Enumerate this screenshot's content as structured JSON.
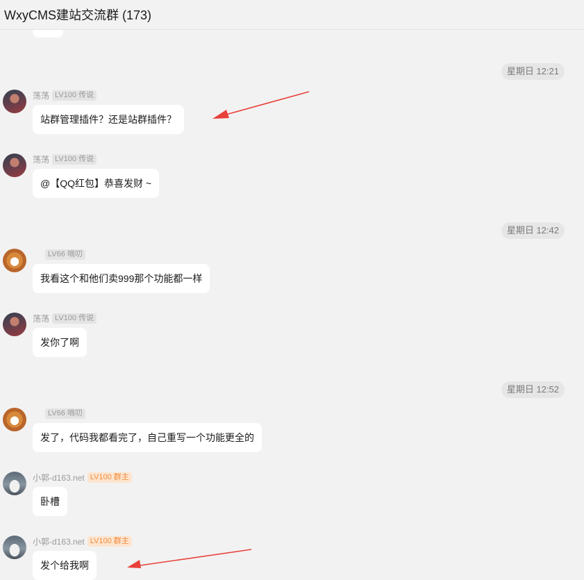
{
  "header": {
    "title": "WxyCMS建站交流群 (173)"
  },
  "timestamps": [
    "星期日 12:21",
    "星期日 12:42",
    "星期日 12:52"
  ],
  "messages": [
    {
      "nick": "荡荡",
      "badge": "LV100 传说",
      "text": "站群管理插件？还是站群插件？"
    },
    {
      "nick": "荡荡",
      "badge": "LV100 传说",
      "text": "@【QQ红包】恭喜发财 ~"
    },
    {
      "nick": "",
      "badge": "LV66 嘀叨",
      "text": "我看这个和他们卖999那个功能都一样"
    },
    {
      "nick": "荡荡",
      "badge": "LV100 传说",
      "text": "发你了啊"
    },
    {
      "nick": "",
      "badge": "LV66 嘀叨",
      "text": "发了，代码我都看完了，自己重写一个功能更全的"
    },
    {
      "nick": "小郭-d163.net",
      "badge": "LV100 群主",
      "text": "卧槽"
    },
    {
      "nick": "小郭-d163.net",
      "badge": "LV100 群主",
      "text": "发个给我啊"
    }
  ],
  "colors": {
    "background": "#f2f2f2",
    "bubble": "#ffffff",
    "owner_badge": "#f08a3c",
    "arrow": "#e8403a"
  }
}
